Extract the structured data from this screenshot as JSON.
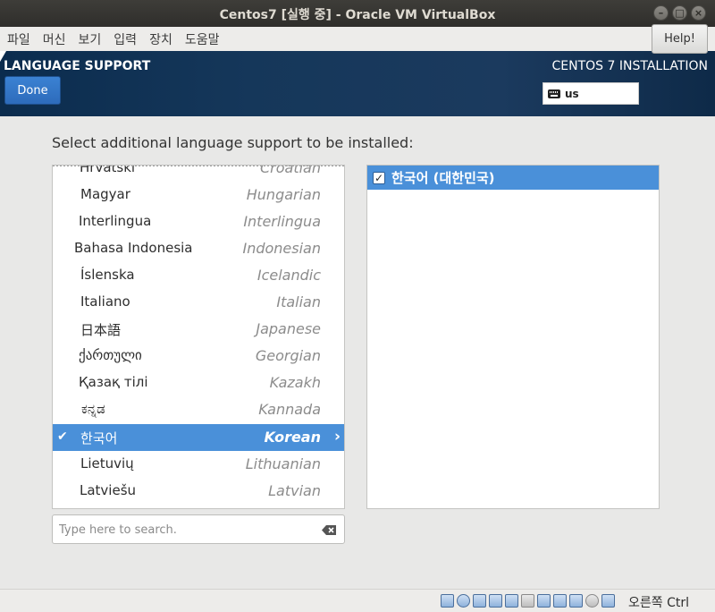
{
  "window": {
    "title": "Centos7 [실행 중] - Oracle VM VirtualBox",
    "minimize": "–",
    "maximize": "□",
    "close": "×"
  },
  "menubar": {
    "items": [
      "파일",
      "머신",
      "보기",
      "입력",
      "장치",
      "도움말"
    ]
  },
  "header": {
    "spoke_title": "LANGUAGE SUPPORT",
    "done_label": "Done",
    "product_title": "CENTOS 7 INSTALLATION",
    "keyboard_layout": "us",
    "help_label": "Help!"
  },
  "main": {
    "prompt": "Select additional language support to be installed:",
    "languages": [
      {
        "native": "Hrvatski",
        "english": "Croatian"
      },
      {
        "native": "Magyar",
        "english": "Hungarian"
      },
      {
        "native": "Interlingua",
        "english": "Interlingua"
      },
      {
        "native": "Bahasa Indonesia",
        "english": "Indonesian"
      },
      {
        "native": "Íslenska",
        "english": "Icelandic"
      },
      {
        "native": "Italiano",
        "english": "Italian"
      },
      {
        "native": "日本語",
        "english": "Japanese"
      },
      {
        "native": "ქართული",
        "english": "Georgian"
      },
      {
        "native": "Қазақ тілі",
        "english": "Kazakh"
      },
      {
        "native": "ಕನ್ನಡ",
        "english": "Kannada"
      },
      {
        "native": "한국어",
        "english": "Korean",
        "selected": true
      },
      {
        "native": "Lietuvių",
        "english": "Lithuanian"
      },
      {
        "native": "Latviešu",
        "english": "Latvian"
      }
    ],
    "search_placeholder": "Type here to search.",
    "locales": [
      {
        "label": "한국어 (대한민국)",
        "checked": true
      }
    ]
  },
  "statusbar": {
    "host_key": "오른쪽 Ctrl"
  },
  "colors": {
    "selection": "#4a90d9",
    "header_bg": "#15375a",
    "done_button": "#3b82d3"
  }
}
